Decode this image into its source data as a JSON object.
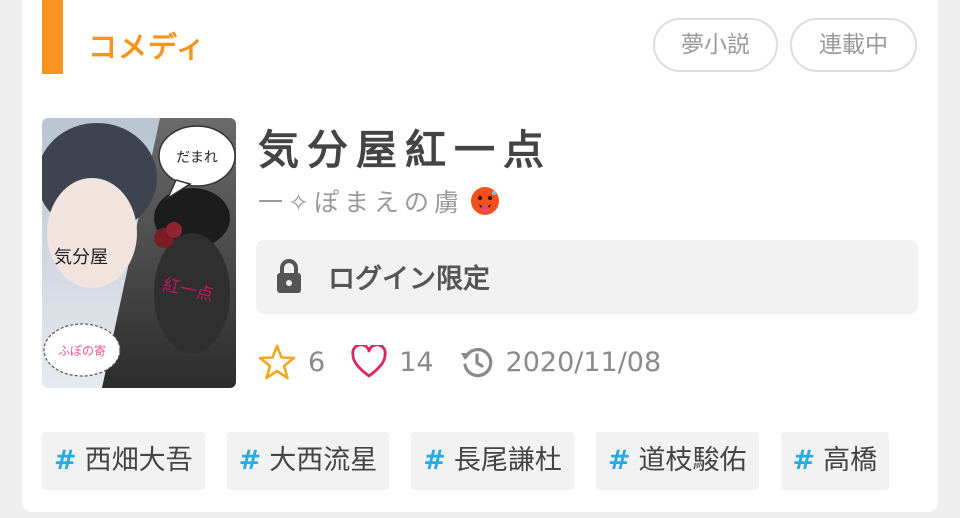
{
  "genre": "コメディ",
  "badges": [
    "夢小説",
    "連載中"
  ],
  "cover": {
    "bubble_top": "だまれ",
    "text_left": "気分屋",
    "text_right": "紅一点",
    "bubble_bottom": "ふぽの寄"
  },
  "title": "気分屋紅一点",
  "author": "一✧ぽまえの虜",
  "author_emoji": "hot-face-emoji",
  "access": {
    "label": "ログイン限定",
    "icon": "lock-icon"
  },
  "stats": {
    "stars": "6",
    "likes": "14",
    "updated": "2020/11/08"
  },
  "tags": [
    "西畑大吾",
    "大西流星",
    "長尾謙杜",
    "道枝駿佑",
    "高橋"
  ],
  "colors": {
    "accent": "#f7931e",
    "hash": "#29abe2",
    "heart": "#e0245e",
    "star": "#f5a623"
  }
}
